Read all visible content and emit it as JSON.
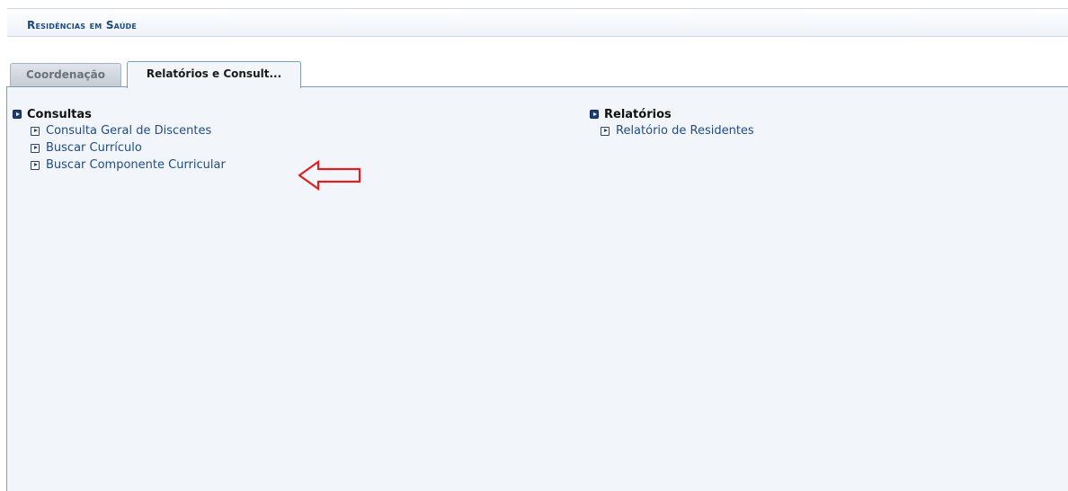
{
  "header": {
    "title": "Residências em Saúde"
  },
  "tabs": [
    {
      "label": "Coordenação",
      "active": false
    },
    {
      "label": "Relatórios e Consult...",
      "active": true
    }
  ],
  "consultas": {
    "title": "Consultas",
    "items": [
      {
        "label": "Consulta Geral de Discentes"
      },
      {
        "label": "Buscar Currículo"
      },
      {
        "label": "Buscar Componente Curricular"
      }
    ]
  },
  "relatorios": {
    "title": "Relatórios",
    "items": [
      {
        "label": "Relatório de Residentes"
      }
    ]
  },
  "annotation": {
    "arrow_color": "#e02020",
    "points_to": "Buscar Componente Curricular"
  },
  "colors": {
    "link": "#1d4c87",
    "header_text": "#1c4a7f",
    "panel_bg": "#f2f6fa",
    "panel_border": "#7f9db9"
  }
}
